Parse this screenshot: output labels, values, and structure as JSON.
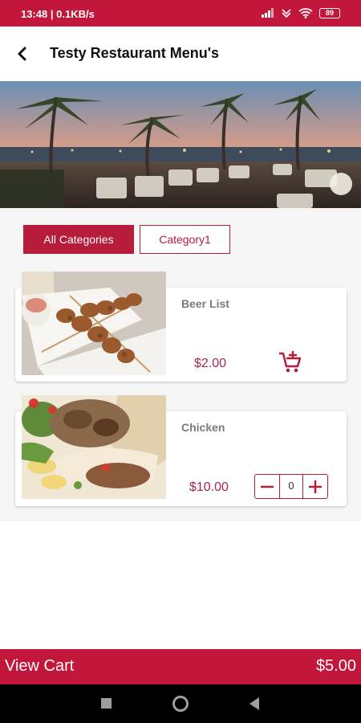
{
  "status_bar": {
    "time": "13:48 | 0.1KB/s",
    "battery": "89"
  },
  "header": {
    "title": "Testy Restaurant Menu's",
    "back_icon": "arrow-left-icon"
  },
  "categories": [
    {
      "label": "All Categories",
      "active": true
    },
    {
      "label": "Category1",
      "active": false
    }
  ],
  "items": [
    {
      "name": "Beer List",
      "price": "$2.00",
      "action": "add-to-cart"
    },
    {
      "name": "Chicken",
      "price": "$10.00",
      "action": "quantity",
      "quantity": "0"
    }
  ],
  "cart": {
    "label": "View Cart",
    "total": "$5.00"
  },
  "colors": {
    "accent": "#c2163a",
    "price": "#a8274a"
  }
}
